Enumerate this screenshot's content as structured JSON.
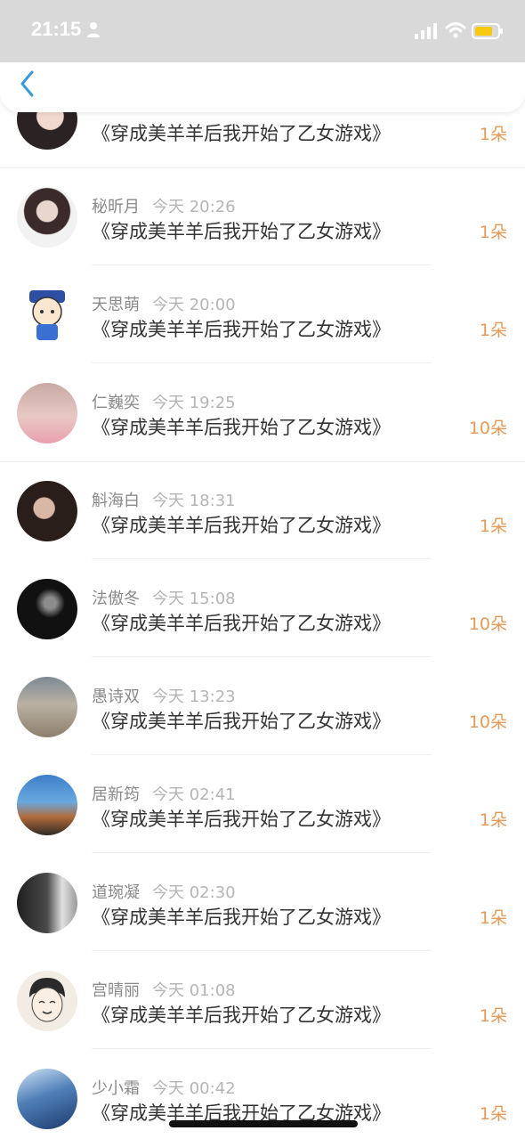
{
  "status_bar": {
    "time": "21:15"
  },
  "rows": [
    {
      "name": "",
      "time": "",
      "title": "《穿成美羊羊后我开始了乙女游戏》",
      "amount": "1朵"
    },
    {
      "name": "秘昕月",
      "time": "今天 20:26",
      "title": "《穿成美羊羊后我开始了乙女游戏》",
      "amount": "1朵"
    },
    {
      "name": "天思萌",
      "time": "今天 20:00",
      "title": "《穿成美羊羊后我开始了乙女游戏》",
      "amount": "1朵"
    },
    {
      "name": "仁巍奕",
      "time": "今天 19:25",
      "title": "《穿成美羊羊后我开始了乙女游戏》",
      "amount": "10朵"
    },
    {
      "name": "斛海白",
      "time": "今天 18:31",
      "title": "《穿成美羊羊后我开始了乙女游戏》",
      "amount": "1朵"
    },
    {
      "name": "法傲冬",
      "time": "今天 15:08",
      "title": "《穿成美羊羊后我开始了乙女游戏》",
      "amount": "10朵"
    },
    {
      "name": "愚诗双",
      "time": "今天 13:23",
      "title": "《穿成美羊羊后我开始了乙女游戏》",
      "amount": "10朵"
    },
    {
      "name": "居新筠",
      "time": "今天 02:41",
      "title": "《穿成美羊羊后我开始了乙女游戏》",
      "amount": "1朵"
    },
    {
      "name": "道琬凝",
      "time": "今天 02:30",
      "title": "《穿成美羊羊后我开始了乙女游戏》",
      "amount": "1朵"
    },
    {
      "name": "宫晴丽",
      "time": "今天 01:08",
      "title": "《穿成美羊羊后我开始了乙女游戏》",
      "amount": "1朵"
    },
    {
      "name": "少小霜",
      "time": "今天 00:42",
      "title": "《穿成美羊羊后我开始了乙女游戏》",
      "amount": "1朵"
    }
  ],
  "colors": {
    "accent": "#3a9ad9",
    "amount": "#e59a57",
    "status_bar": "#d9d9d9"
  }
}
